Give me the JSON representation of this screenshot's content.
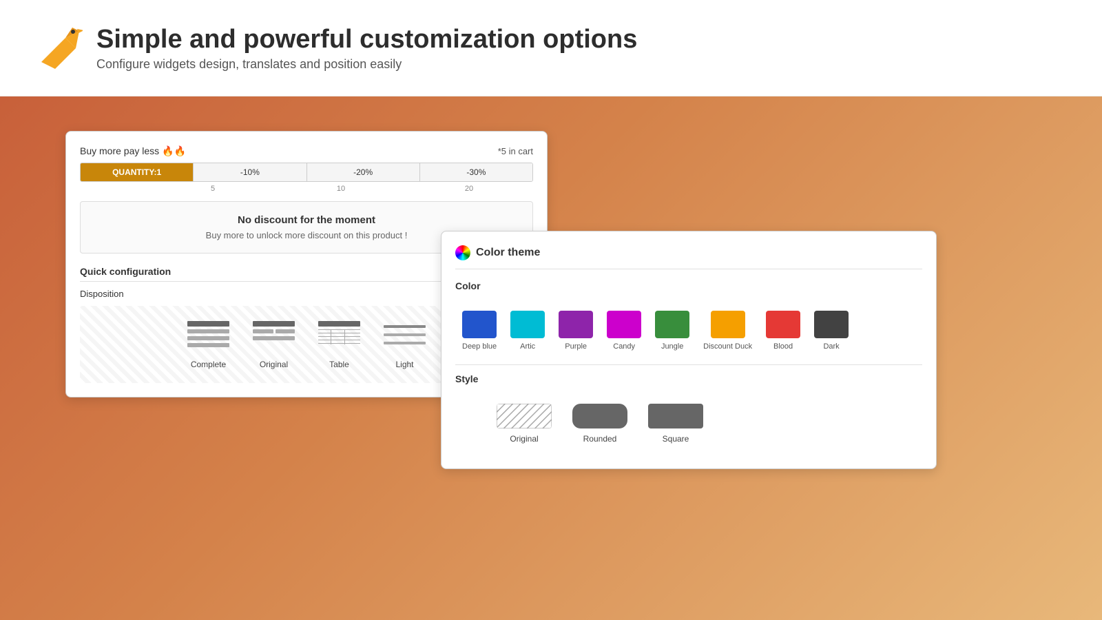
{
  "header": {
    "title": "Simple and powerful customization options",
    "subtitle": "Configure widgets design, translates and position easily"
  },
  "widget1": {
    "buy_more_title": "Buy more pay less 🔥🔥",
    "in_cart": "*5 in cart",
    "quantity_label": "QUANTITY:1",
    "discounts": [
      "-10%",
      "-20%",
      "-30%"
    ],
    "qty_markers": [
      "5",
      "10",
      "20"
    ],
    "no_discount_title": "No discount for the moment",
    "no_discount_sub": "Buy more to unlock more discount on this product !",
    "quick_config_label": "Quick configuration",
    "disposition_label": "Disposition",
    "disposition_options": [
      {
        "label": "Complete"
      },
      {
        "label": "Original"
      },
      {
        "label": "Table"
      },
      {
        "label": "Light"
      }
    ]
  },
  "widget2": {
    "title": "Color theme",
    "color_section_label": "Color",
    "colors": [
      {
        "name": "Deep blue",
        "hex": "#2255cc"
      },
      {
        "name": "Artic",
        "hex": "#00bcd4"
      },
      {
        "name": "Purple",
        "hex": "#8e24aa"
      },
      {
        "name": "Candy",
        "hex": "#cc00cc"
      },
      {
        "name": "Jungle",
        "hex": "#388e3c"
      },
      {
        "name": "Discount Duck",
        "hex": "#f59f00"
      },
      {
        "name": "Blood",
        "hex": "#e53935"
      },
      {
        "name": "Dark",
        "hex": "#424242"
      }
    ],
    "style_section_label": "Style",
    "styles": [
      {
        "name": "Original"
      },
      {
        "name": "Rounded"
      },
      {
        "name": "Square"
      }
    ]
  }
}
